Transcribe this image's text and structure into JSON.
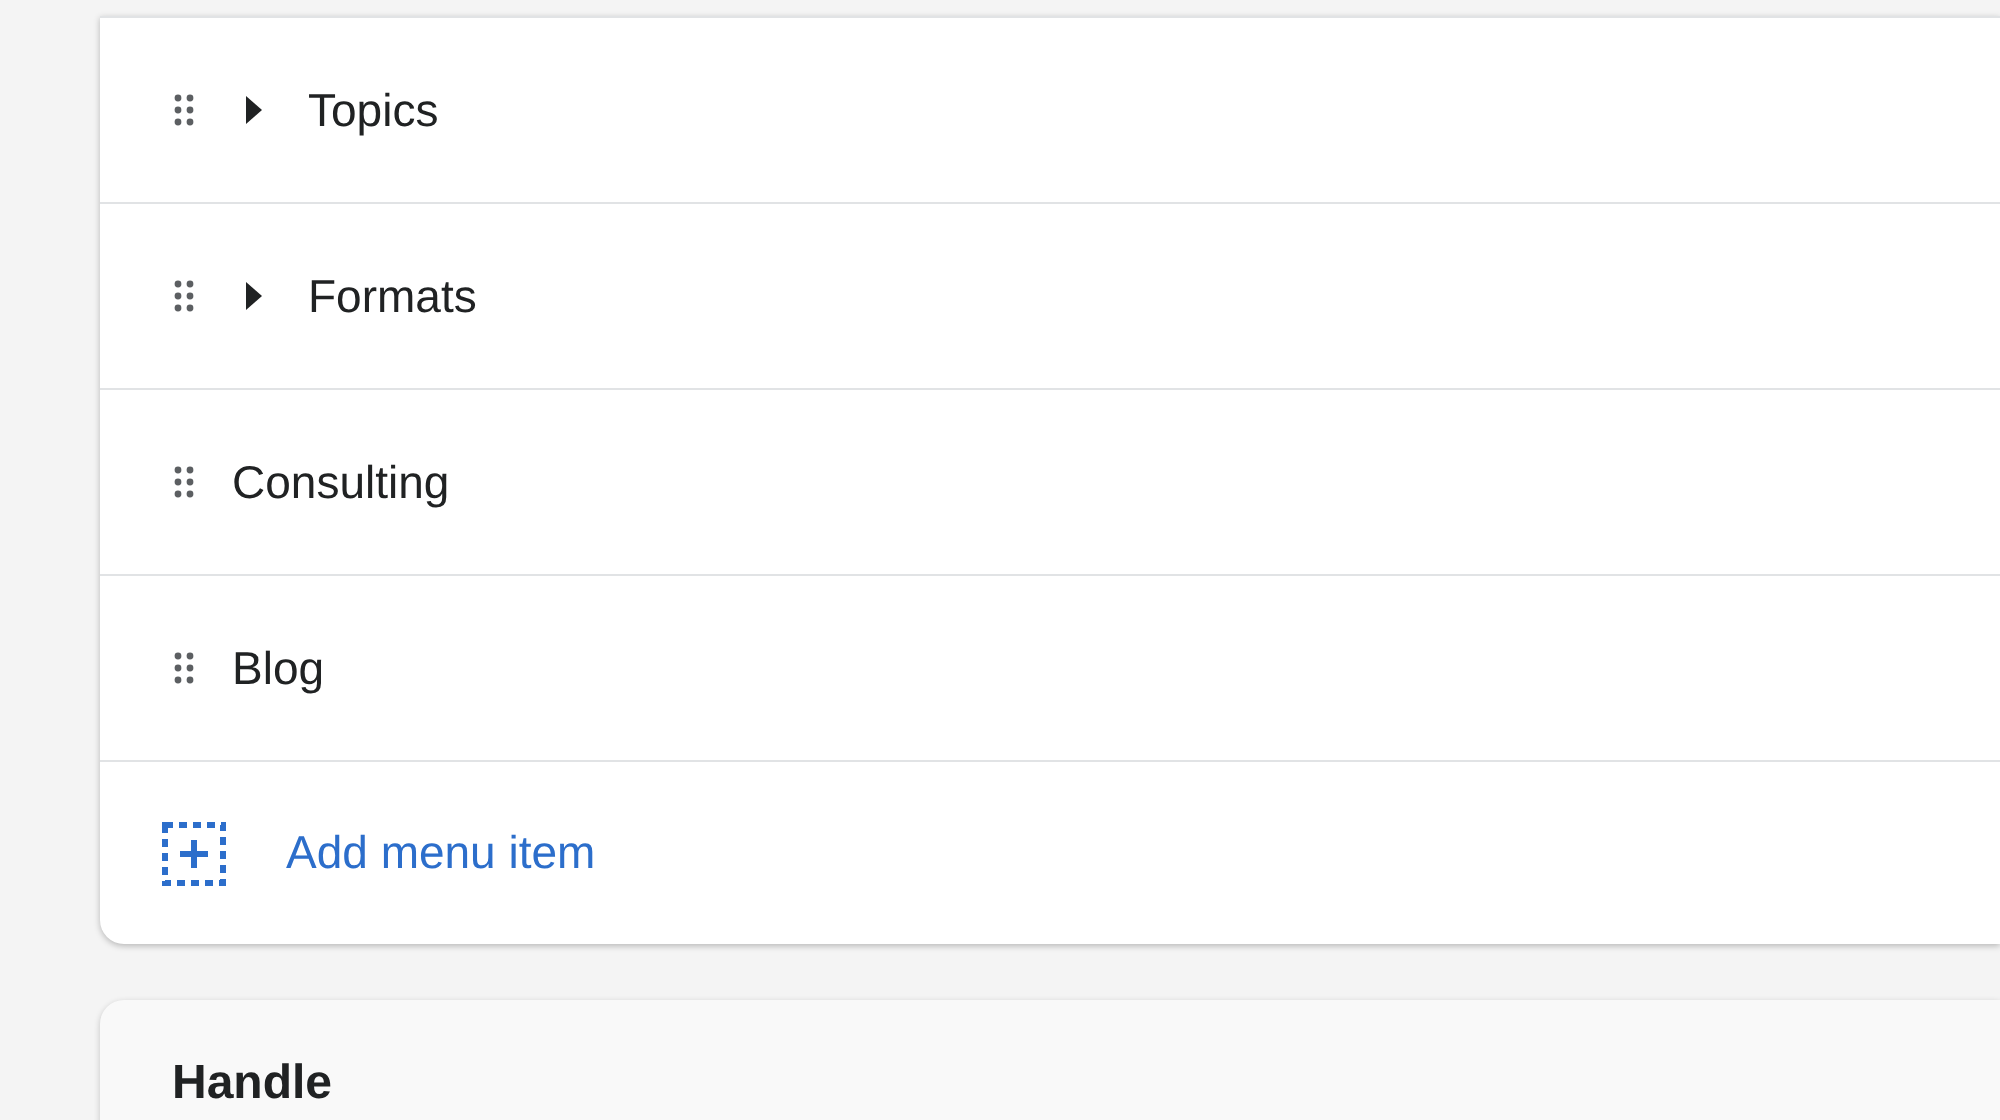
{
  "menu_items": [
    {
      "kind": "group",
      "label": "Topics",
      "expanded": false
    },
    {
      "kind": "group",
      "label": "Formats",
      "expanded": false
    },
    {
      "kind": "link",
      "label": "Consulting"
    },
    {
      "kind": "link",
      "label": "Blog"
    }
  ],
  "add_item": {
    "label": "Add menu item"
  },
  "handle_section": {
    "title": "Handle"
  }
}
